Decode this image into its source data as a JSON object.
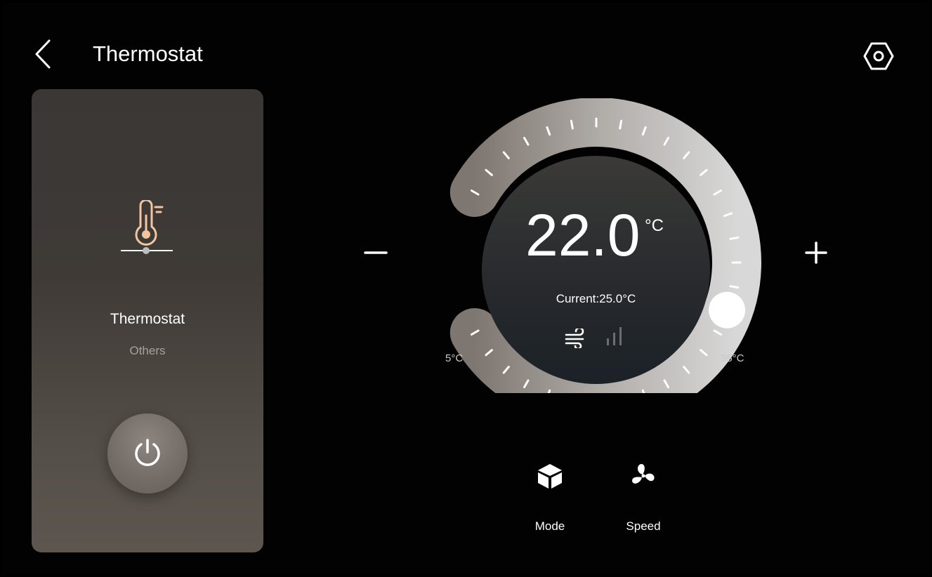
{
  "header": {
    "title": "Thermostat",
    "back_icon": "chevron-left-icon",
    "settings_icon": "hexagon-settings-icon"
  },
  "device_card": {
    "icon": "thermometer-icon",
    "name": "Thermostat",
    "category": "Others",
    "power_icon": "power-icon",
    "accent_color": "#f2c4a0"
  },
  "dial": {
    "set_value": "22.0",
    "set_unit": "°C",
    "current_label": "Current:25.0°C",
    "min_label": "5°C",
    "max_label": "35°C",
    "min": 5,
    "max": 35,
    "setpoint": 22.0,
    "wind_icon": "wind-icon",
    "signal_icon": "signal-bars-icon",
    "minus_icon": "minus-icon",
    "plus_icon": "plus-icon"
  },
  "controls": [
    {
      "label": "Mode",
      "icon": "cube-icon"
    },
    {
      "label": "Speed",
      "icon": "fan-icon"
    }
  ]
}
